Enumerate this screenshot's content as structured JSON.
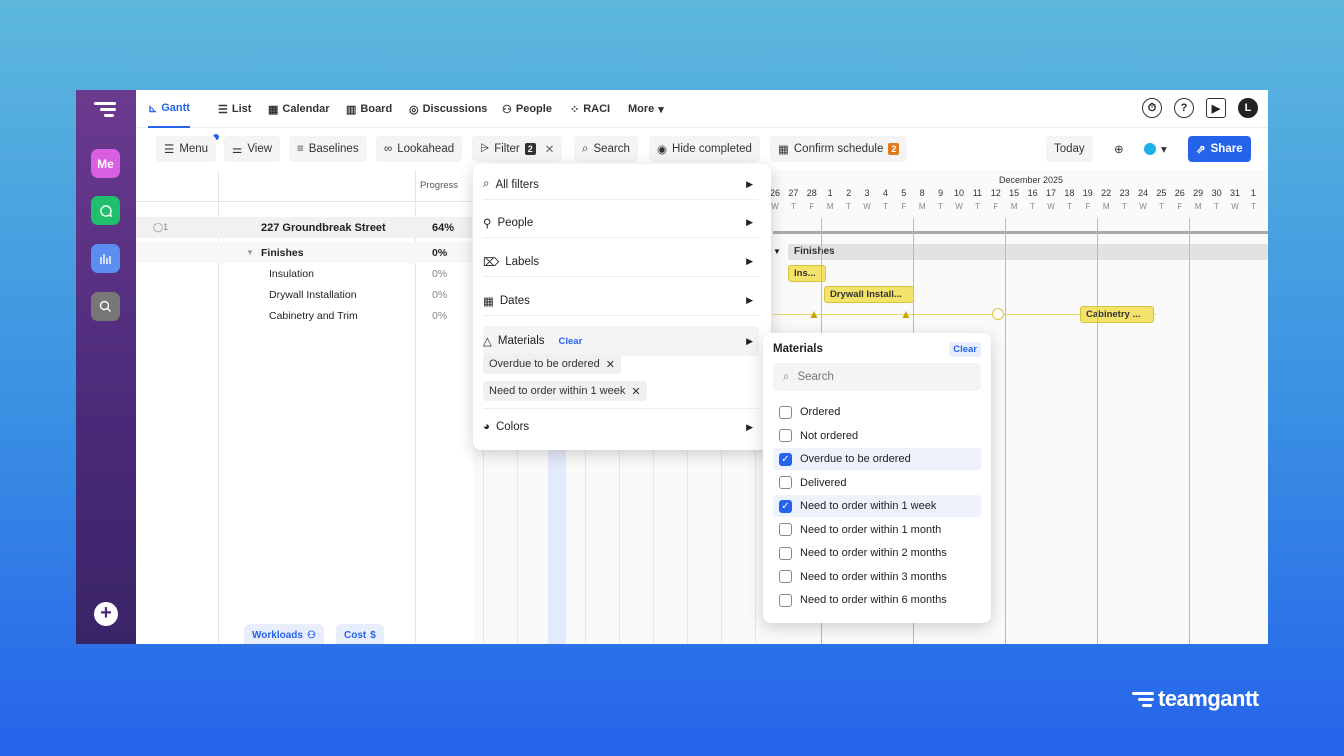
{
  "nav": {
    "tabs": [
      {
        "label": "Gantt",
        "icon": "gantt-icon"
      },
      {
        "label": "List",
        "icon": "list-icon"
      },
      {
        "label": "Calendar",
        "icon": "calendar-icon"
      },
      {
        "label": "Board",
        "icon": "board-icon"
      },
      {
        "label": "Discussions",
        "icon": "discussions-icon"
      },
      {
        "label": "People",
        "icon": "people-icon"
      },
      {
        "label": "RACI",
        "icon": "raci-icon"
      },
      {
        "label": "More",
        "icon": "chevron-down-icon"
      }
    ],
    "avatar": "L"
  },
  "rail": {
    "me": "Me"
  },
  "toolbar": {
    "menu": "Menu",
    "view": "View",
    "baselines": "Baselines",
    "lookahead": "Lookahead",
    "filter": "Filter",
    "filter_count": "2",
    "search": "Search",
    "hide_completed": "Hide completed",
    "confirm_schedule": "Confirm schedule",
    "confirm_count": "2",
    "today": "Today",
    "share": "Share"
  },
  "grid": {
    "progress_header": "Progress",
    "project": {
      "comment_count": "1",
      "name": "227 Groundbreak Street",
      "progress": "64%"
    },
    "group": {
      "name": "Finishes",
      "progress": "0%"
    },
    "tasks": [
      {
        "name": "Insulation",
        "progress": "0%"
      },
      {
        "name": "Drywall Installation",
        "progress": "0%"
      },
      {
        "name": "Cabinetry and Trim",
        "progress": "0%"
      }
    ],
    "footer": {
      "workloads": "Workloads",
      "cost": "Cost"
    }
  },
  "gantt": {
    "month": "December 2025",
    "days": [
      "26",
      "27",
      "28",
      "1",
      "2",
      "3",
      "4",
      "5",
      "8",
      "9",
      "10",
      "11",
      "12",
      "15",
      "16",
      "17",
      "18",
      "19",
      "22",
      "23",
      "24",
      "25",
      "26",
      "29",
      "30",
      "31",
      "1"
    ],
    "letters": [
      "W",
      "T",
      "F",
      "M",
      "T",
      "W",
      "T",
      "F",
      "M",
      "T",
      "W",
      "T",
      "F",
      "M",
      "T",
      "W",
      "T",
      "F",
      "M",
      "T",
      "W",
      "T",
      "F",
      "M",
      "T",
      "W",
      "T"
    ],
    "group_bar": "Finishes",
    "bars": [
      "Ins...",
      "Drywall Install...",
      "Cabinetry ..."
    ]
  },
  "filter_menu": {
    "all_filters": "All filters",
    "people": "People",
    "labels": "Labels",
    "dates": "Dates",
    "materials": "Materials",
    "materials_clear": "Clear",
    "chips": [
      "Overdue to be ordered",
      "Need to order within 1 week"
    ],
    "colors": "Colors"
  },
  "materials_sub": {
    "title": "Materials",
    "clear": "Clear",
    "search_placeholder": "Search",
    "options": [
      {
        "label": "Ordered",
        "checked": false
      },
      {
        "label": "Not ordered",
        "checked": false
      },
      {
        "label": "Overdue to be ordered",
        "checked": true
      },
      {
        "label": "Delivered",
        "checked": false
      },
      {
        "label": "Need to order within 1 week",
        "checked": true
      },
      {
        "label": "Need to order within 1 month",
        "checked": false
      },
      {
        "label": "Need to order within 2 months",
        "checked": false
      },
      {
        "label": "Need to order within 3 months",
        "checked": false
      },
      {
        "label": "Need to order within 6 months",
        "checked": false
      }
    ]
  },
  "brand": "teamgantt",
  "colors": {
    "accent": "#2563eb",
    "bar": "#f4e36b",
    "rail": "#4a2a78"
  }
}
